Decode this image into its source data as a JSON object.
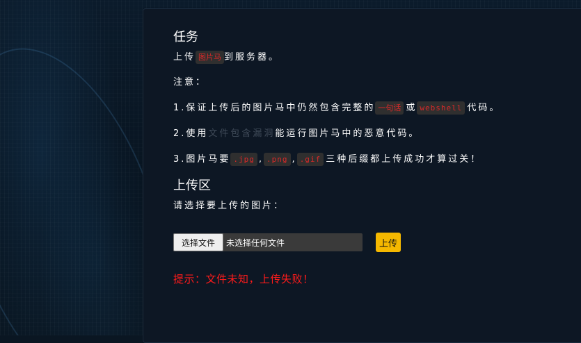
{
  "task": {
    "heading": "任务",
    "line1_prefix": "上传",
    "line1_code": "图片马",
    "line1_suffix": "到服务器。",
    "note_label": "注意：",
    "rule1_prefix": "1.保证上传后的图片马中仍然包含完整的",
    "rule1_code1": "一句话",
    "rule1_mid": "或",
    "rule1_code2": "webshell",
    "rule1_suffix": "代码。",
    "rule2_prefix": "2.使用",
    "rule2_dim": "文件包含漏洞",
    "rule2_suffix": "能运行图片马中的恶意代码。",
    "rule3_prefix": "3.图片马要",
    "rule3_code1": ".jpg",
    "rule3_sep1": ",",
    "rule3_code2": ".png",
    "rule3_sep2": ",",
    "rule3_code3": ".gif",
    "rule3_suffix": "三种后缀都上传成功才算过关！"
  },
  "upload": {
    "heading": "上传区",
    "prompt": "请选择要上传的图片：",
    "choose_file_label": "选择文件",
    "no_file_label": "未选择任何文件",
    "submit_label": "上传"
  },
  "message": {
    "error": "提示：文件未知，上传失败！",
    "error_color": "#ff1b1b"
  },
  "colors": {
    "accent": "#f5b800",
    "code_text": "#d92a2a",
    "code_bg": "#2f2f2f",
    "panel_bg": "#0d1724"
  }
}
